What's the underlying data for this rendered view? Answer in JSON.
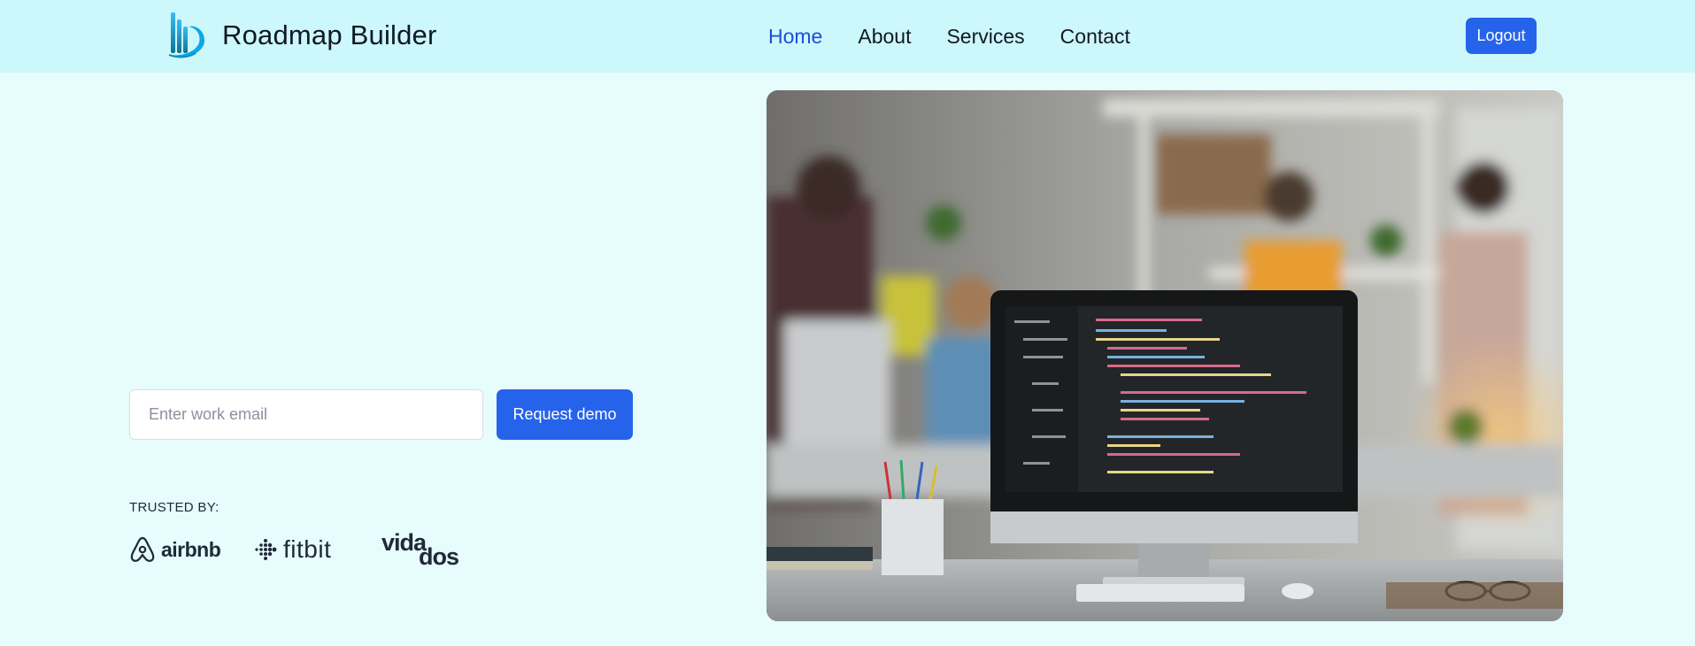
{
  "header": {
    "brand_name": "Roadmap Builder",
    "logo_icon": "roadmap-builder-logo-icon",
    "nav": [
      {
        "label": "Home",
        "active": true
      },
      {
        "label": "About",
        "active": false
      },
      {
        "label": "Services",
        "active": false
      },
      {
        "label": "Contact",
        "active": false
      }
    ],
    "logout_label": "Logout"
  },
  "hero": {
    "email_value": "",
    "email_placeholder": "Enter work email",
    "demo_button_label": "Request demo",
    "trusted_label": "TRUSTED BY:",
    "trusted_logos": [
      {
        "name": "airbnb",
        "icon": "airbnb-logo"
      },
      {
        "name": "fitbit",
        "icon": "fitbit-logo"
      },
      {
        "name": "vidados",
        "icon": "vidados-logo"
      }
    ],
    "image_icon": "office-desk-computer-photo"
  },
  "colors": {
    "header_bg": "#ccf7fb",
    "page_bg": "#e6fcfd",
    "accent": "#2563eb",
    "active_nav": "#1d4ed8",
    "text": "#111827"
  }
}
